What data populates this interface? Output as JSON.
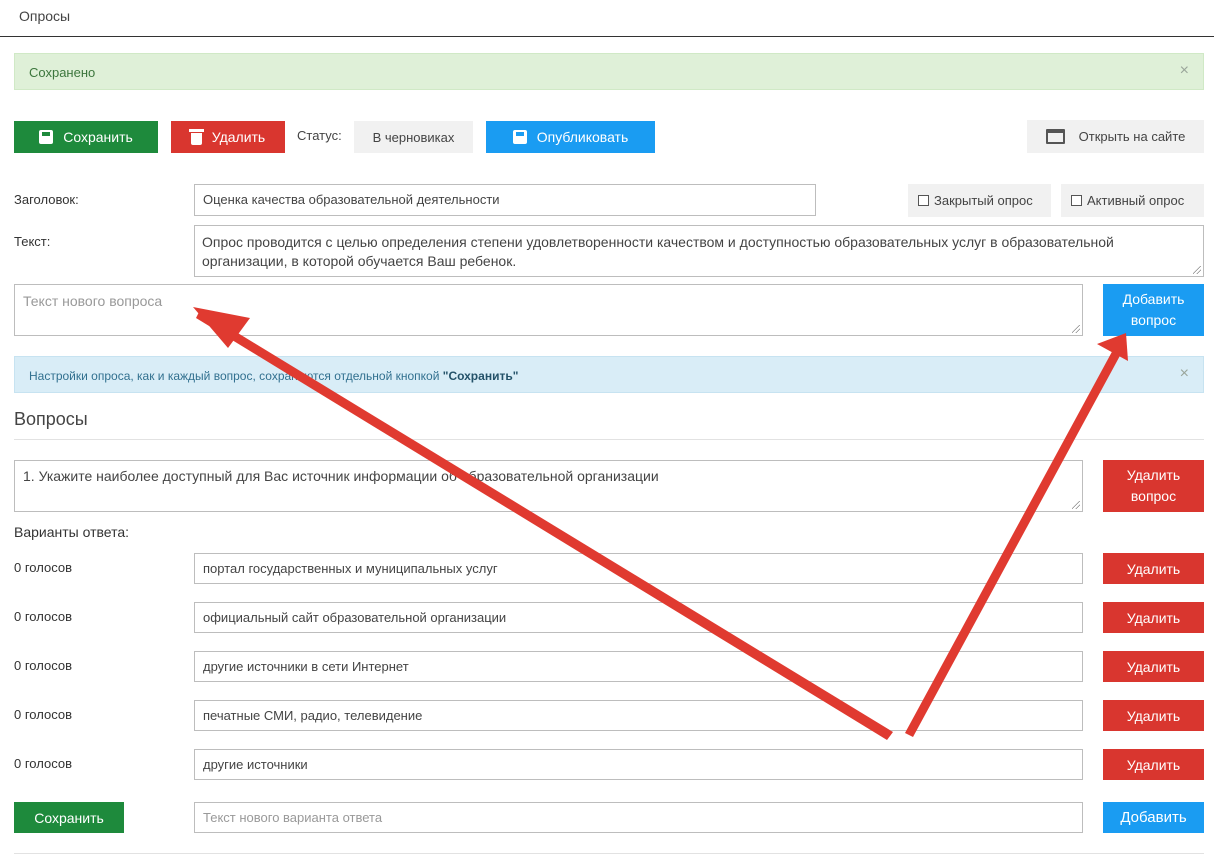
{
  "page": {
    "title": "Опросы"
  },
  "alert_success": {
    "text": "Сохранено",
    "close": "×"
  },
  "toolbar": {
    "save_label": "Сохранить",
    "delete_label": "Удалить",
    "status_label": "Статус:",
    "status_value": "В черновиках",
    "publish_label": "Опубликовать",
    "open_site_label": "Открыть на сайте"
  },
  "form": {
    "title_label": "Заголовок:",
    "title_value": "Оценка качества образовательной деятельности",
    "closed_poll_label": "Закрытый опрос",
    "active_poll_label": "Активный опрос",
    "text_label": "Текст:",
    "text_value": "Опрос проводится с целью определения степени удовлетворенности качеством и доступностью образовательных услуг в образовательной организации, в которой обучается Ваш ребенок.",
    "new_question_placeholder": "Текст нового вопроса",
    "add_question_label": "Добавить вопрос"
  },
  "alert_info": {
    "text": "Настройки опроса, как и каждый вопрос, сохраняются отдельной кнопкой ",
    "emphasis": "\"Сохранить\"",
    "close": "×"
  },
  "questions_section": {
    "title": "Вопросы",
    "question": {
      "text": "1. Укажите наиболее доступный для Вас источник информации об образовательной организации",
      "delete_label": "Удалить вопрос",
      "answers_label": "Варианты ответа:",
      "answers": [
        {
          "votes": "0 голосов",
          "text": "портал государственных и муниципальных услуг",
          "delete": "Удалить"
        },
        {
          "votes": "0 голосов",
          "text": "официальный сайт образовательной организации",
          "delete": "Удалить"
        },
        {
          "votes": "0 голосов",
          "text": "другие источники в сети Интернет",
          "delete": "Удалить"
        },
        {
          "votes": "0 голосов",
          "text": "печатные СМИ, радио, телевидение",
          "delete": "Удалить"
        },
        {
          "votes": "0 голосов",
          "text": "другие источники",
          "delete": "Удалить"
        }
      ],
      "save_label": "Сохранить",
      "new_answer_placeholder": "Текст нового варианта ответа",
      "add_label": "Добавить"
    }
  },
  "colors": {
    "green": "#1e8a3c",
    "red": "#d9362f",
    "blue": "#1a9cf2",
    "annotation_arrow": "#e03a30"
  },
  "icons": [
    "floppy-disk-icon",
    "trash-icon",
    "browser-window-icon",
    "checkbox-icon",
    "close-icon",
    "resize-grip-icon",
    "annotation-arrow"
  ]
}
